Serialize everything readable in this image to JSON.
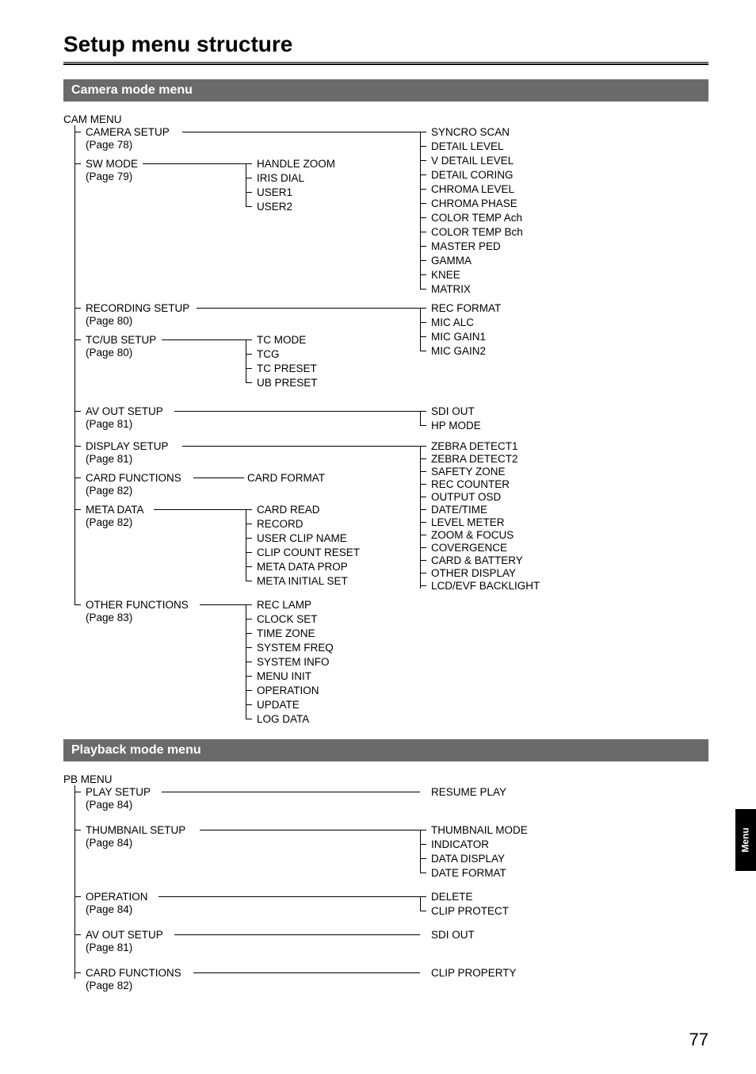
{
  "title": "Setup menu structure",
  "sections": {
    "camera": {
      "header": "Camera mode menu",
      "root": "CAM MENU",
      "col1": [
        {
          "label": "CAMERA SETUP",
          "page": "(Page 78)"
        },
        {
          "label": "SW MODE",
          "page": "(Page 79)"
        },
        {
          "label": "RECORDING SETUP",
          "page": "(Page 80)"
        },
        {
          "label": "TC/UB SETUP",
          "page": "(Page 80)"
        },
        {
          "label": "AV OUT SETUP",
          "page": "(Page 81)"
        },
        {
          "label": "DISPLAY SETUP",
          "page": "(Page 81)"
        },
        {
          "label": "CARD FUNCTIONS",
          "page": "(Page 82)"
        },
        {
          "label": "META DATA",
          "page": "(Page 82)"
        },
        {
          "label": "OTHER FUNCTIONS",
          "page": "(Page 83)"
        }
      ],
      "col2": {
        "sw_mode": [
          "HANDLE ZOOM",
          "IRIS DIAL",
          "USER1",
          "USER2"
        ],
        "tcub": [
          "TC MODE",
          "TCG",
          "TC PRESET",
          "UB PRESET"
        ],
        "card_functions": [
          "CARD FORMAT"
        ],
        "meta_data": [
          "CARD READ",
          "RECORD",
          "USER CLIP NAME",
          "CLIP COUNT RESET",
          "META DATA PROP",
          "META INITIAL SET"
        ],
        "other_functions": [
          "REC LAMP",
          "CLOCK SET",
          "TIME ZONE",
          "SYSTEM FREQ",
          "SYSTEM INFO",
          "MENU INIT",
          "OPERATION",
          "UPDATE",
          "LOG DATA"
        ]
      },
      "col3": {
        "camera_setup": [
          "SYNCRO SCAN",
          "DETAIL LEVEL",
          "V DETAIL LEVEL",
          "DETAIL CORING",
          "CHROMA LEVEL",
          "CHROMA PHASE",
          "COLOR TEMP Ach",
          "COLOR TEMP Bch",
          "MASTER PED",
          "GAMMA",
          "KNEE",
          "MATRIX"
        ],
        "recording_setup": [
          "REC FORMAT",
          "MIC ALC",
          "MIC GAIN1",
          "MIC GAIN2"
        ],
        "av_out": [
          "SDI OUT",
          "HP MODE"
        ],
        "display_setup": [
          "ZEBRA DETECT1",
          "ZEBRA DETECT2",
          "SAFETY ZONE",
          "REC COUNTER",
          "OUTPUT OSD",
          "DATE/TIME",
          "LEVEL METER",
          "ZOOM & FOCUS",
          "COVERGENCE",
          "CARD & BATTERY",
          "OTHER DISPLAY",
          "LCD/EVF BACKLIGHT"
        ]
      }
    },
    "playback": {
      "header": "Playback mode menu",
      "root": "PB MENU",
      "items": [
        {
          "label": "PLAY SETUP",
          "page": "(Page 84)",
          "children": [
            "RESUME PLAY"
          ]
        },
        {
          "label": "THUMBNAIL SETUP",
          "page": "(Page 84)",
          "children": [
            "THUMBNAIL MODE",
            "INDICATOR",
            "DATA DISPLAY",
            "DATE FORMAT"
          ]
        },
        {
          "label": "OPERATION",
          "page": "(Page 84)",
          "children": [
            "DELETE",
            "CLIP PROTECT"
          ]
        },
        {
          "label": "AV OUT SETUP",
          "page": "(Page 81)",
          "children": [
            "SDI OUT"
          ]
        },
        {
          "label": "CARD FUNCTIONS",
          "page": "(Page 82)",
          "children": [
            "CLIP PROPERTY"
          ]
        }
      ]
    }
  },
  "side_tab": "Menu",
  "page_number": "77"
}
